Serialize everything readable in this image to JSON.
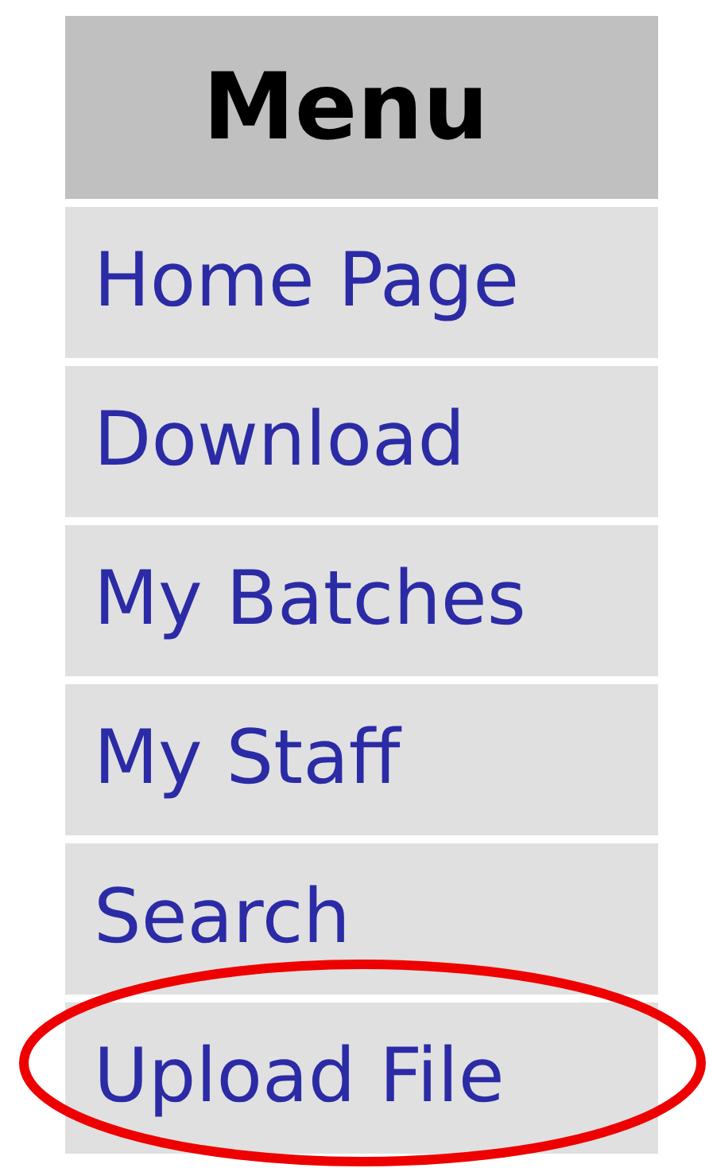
{
  "menu": {
    "title": "Menu",
    "items": [
      {
        "label": "Home Page",
        "circled": false
      },
      {
        "label": "Download",
        "circled": false
      },
      {
        "label": "My Batches",
        "circled": false
      },
      {
        "label": "My Staff",
        "circled": false
      },
      {
        "label": "Search",
        "circled": false
      },
      {
        "label": "Upload File",
        "circled": true
      }
    ]
  }
}
